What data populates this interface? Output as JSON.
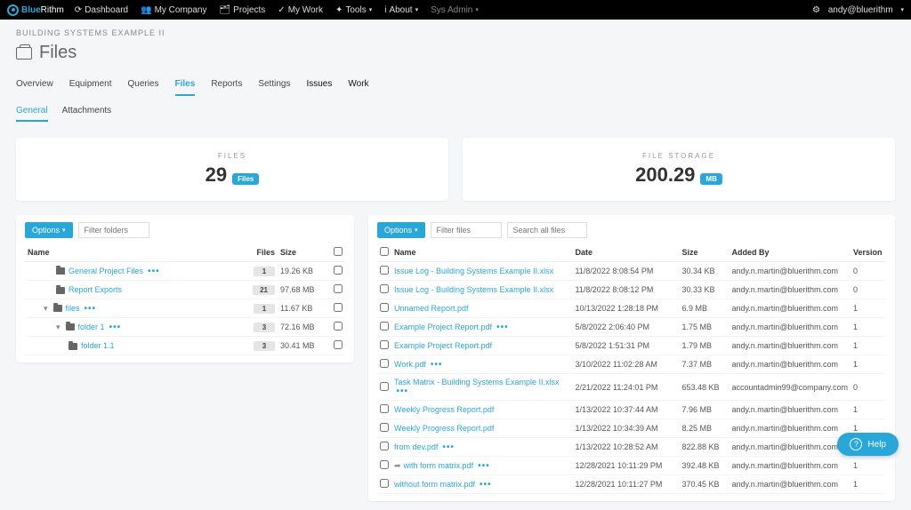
{
  "brand": {
    "blue": "Blue",
    "rithm": "Rithm"
  },
  "nav": {
    "dashboard": "Dashboard",
    "mycompany": "My Company",
    "projects": "Projects",
    "mywork": "My Work",
    "tools": "Tools",
    "about": "About",
    "sysadmin": "Sys Admin",
    "user": "andy@bluerithm"
  },
  "breadcrumb": "BUILDING SYSTEMS EXAMPLE II",
  "page_title": "Files",
  "tabs": {
    "overview": "Overview",
    "equipment": "Equipment",
    "queries": "Queries",
    "files": "Files",
    "reports": "Reports",
    "settings": "Settings",
    "issues": "Issues",
    "work": "Work"
  },
  "subtabs": {
    "general": "General",
    "attachments": "Attachments"
  },
  "cards": {
    "files_label": "FILES",
    "files_value": "29",
    "files_unit": "Files",
    "storage_label": "FILE STORAGE",
    "storage_value": "200.29",
    "storage_unit": "MB"
  },
  "folders": {
    "options": "Options",
    "filter_ph": "Filter folders",
    "headers": {
      "name": "Name",
      "files": "Files",
      "size": "Size"
    },
    "rows": [
      {
        "indent": 1,
        "toggle": "",
        "name": "General Project Files",
        "count": "1",
        "size": "19.26 KB",
        "dots": true
      },
      {
        "indent": 1,
        "toggle": "",
        "name": "Report Exports",
        "count": "21",
        "size": "97.68 MB",
        "dots": false
      },
      {
        "indent": 0,
        "toggle": "▾",
        "name": "files",
        "count": "1",
        "size": "11.67 KB",
        "dots": true
      },
      {
        "indent": 1,
        "toggle": "▾",
        "name": "folder 1",
        "count": "3",
        "size": "72.16 MB",
        "dots": true
      },
      {
        "indent": 2,
        "toggle": "",
        "name": "folder 1.1",
        "count": "3",
        "size": "30.41 MB",
        "dots": false
      }
    ]
  },
  "files": {
    "options": "Options",
    "filter_ph": "Filter files",
    "search_ph": "Search all files",
    "headers": {
      "name": "Name",
      "date": "Date",
      "size": "Size",
      "added": "Added By",
      "version": "Version"
    },
    "rows": [
      {
        "share": false,
        "name": "Issue Log - Building Systems Example II.xlsx",
        "dots": false,
        "date": "11/8/2022 8:08:54 PM",
        "size": "30.34 KB",
        "added": "andy.n.martin@bluerithm.com",
        "version": "0"
      },
      {
        "share": false,
        "name": "Issue Log - Building Systems Example II.xlsx",
        "dots": false,
        "date": "11/8/2022 8:08:12 PM",
        "size": "30.33 KB",
        "added": "andy.n.martin@bluerithm.com",
        "version": "0"
      },
      {
        "share": false,
        "name": "Unnamed Report.pdf",
        "dots": false,
        "date": "10/13/2022 1:28:18 PM",
        "size": "6.9 MB",
        "added": "andy.n.martin@bluerithm.com",
        "version": "1"
      },
      {
        "share": false,
        "name": "Example Project Report.pdf",
        "dots": true,
        "date": "5/8/2022 2:06:40 PM",
        "size": "1.75 MB",
        "added": "andy.n.martin@bluerithm.com",
        "version": "1"
      },
      {
        "share": false,
        "name": "Example Project Report.pdf",
        "dots": false,
        "date": "5/8/2022 1:51:31 PM",
        "size": "1.79 MB",
        "added": "andy.n.martin@bluerithm.com",
        "version": "1"
      },
      {
        "share": false,
        "name": "Work.pdf",
        "dots": true,
        "date": "3/10/2022 11:02:28 AM",
        "size": "7.37 MB",
        "added": "andy.n.martin@bluerithm.com",
        "version": "1"
      },
      {
        "share": false,
        "name": "Task Matrix - Building Systems Example II.xlsx",
        "dots": true,
        "date": "2/21/2022 11:24:01 PM",
        "size": "653.48 KB",
        "added": "accountadmin99@company.com",
        "version": "0"
      },
      {
        "share": false,
        "name": "Weekly Progress Report.pdf",
        "dots": false,
        "date": "1/13/2022 10:37:44 AM",
        "size": "7.96 MB",
        "added": "andy.n.martin@bluerithm.com",
        "version": "1"
      },
      {
        "share": false,
        "name": "Weekly Progress Report.pdf",
        "dots": false,
        "date": "1/13/2022 10:34:39 AM",
        "size": "8.25 MB",
        "added": "andy.n.martin@bluerithm.com",
        "version": "1"
      },
      {
        "share": false,
        "name": "from dev.pdf",
        "dots": true,
        "date": "1/13/2022 10:28:52 AM",
        "size": "822.88 KB",
        "added": "andy.n.martin@bluerithm.com",
        "version": "1"
      },
      {
        "share": true,
        "name": "with form matrix.pdf",
        "dots": true,
        "date": "12/28/2021 10:11:29 PM",
        "size": "392.48 KB",
        "added": "andy.n.martin@bluerithm.com",
        "version": "1"
      },
      {
        "share": false,
        "name": "without form matrix.pdf",
        "dots": true,
        "date": "12/28/2021 10:11:27 PM",
        "size": "370.45 KB",
        "added": "andy.n.martin@bluerithm.com",
        "version": "1"
      }
    ]
  },
  "help": "Help"
}
